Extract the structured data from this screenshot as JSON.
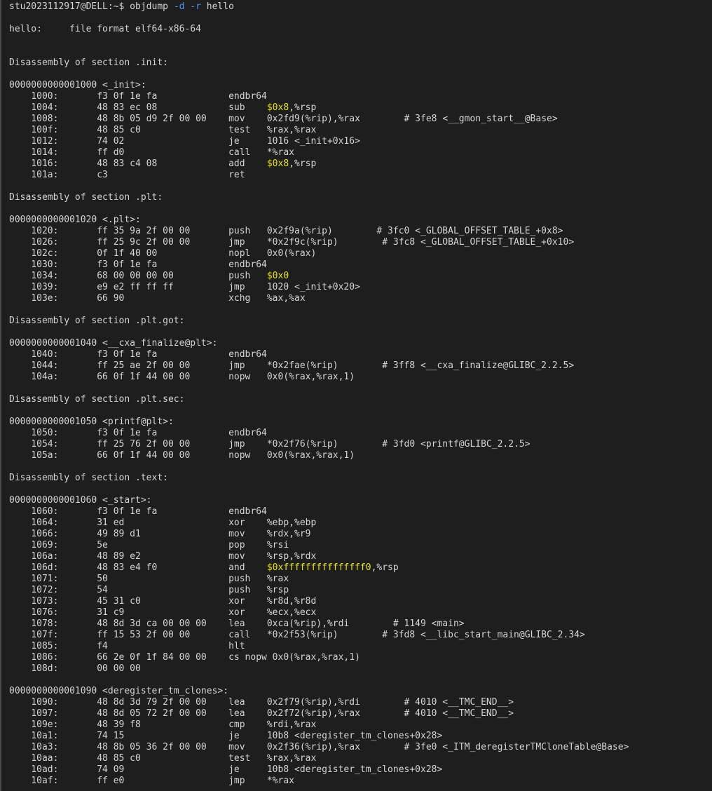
{
  "terminal": {
    "colors": {
      "background": "#1e1e1e",
      "foreground": "#d4d4d4",
      "option": "#4f8ff0",
      "immediate": "#e5e510"
    },
    "lines": [
      [
        {
          "t": "stu2023112917@DELL:~$ objdump "
        },
        {
          "t": "-d",
          "c": "opt"
        },
        {
          "t": " "
        },
        {
          "t": "-r",
          "c": "opt"
        },
        {
          "t": " hello"
        }
      ],
      [
        {
          "t": ""
        }
      ],
      [
        {
          "t": "hello:     file format elf64-x86-64"
        }
      ],
      [
        {
          "t": ""
        }
      ],
      [
        {
          "t": ""
        }
      ],
      [
        {
          "t": "Disassembly of section .init:"
        }
      ],
      [
        {
          "t": ""
        }
      ],
      [
        {
          "t": "0000000000001000 <_init>:"
        }
      ],
      [
        {
          "t": "    1000:       f3 0f 1e fa             endbr64"
        }
      ],
      [
        {
          "t": "    1004:       48 83 ec 08             sub    "
        },
        {
          "t": "$0x8",
          "c": "imm"
        },
        {
          "t": ",%rsp"
        }
      ],
      [
        {
          "t": "    1008:       48 8b 05 d9 2f 00 00    mov    "
        },
        {
          "t": "0x2fd9(%rip),%rax        # 3fe8 <__gmon_start__@Base>"
        }
      ],
      [
        {
          "t": "    100f:       48 85 c0                test   %rax,%rax"
        }
      ],
      [
        {
          "t": "    1012:       74 02                   je     1016 <_init+0x16>"
        }
      ],
      [
        {
          "t": "    1014:       ff d0                   call   *%rax"
        }
      ],
      [
        {
          "t": "    1016:       48 83 c4 08             add    "
        },
        {
          "t": "$0x8",
          "c": "imm"
        },
        {
          "t": ",%rsp"
        }
      ],
      [
        {
          "t": "    101a:       c3                      ret"
        }
      ],
      [
        {
          "t": ""
        }
      ],
      [
        {
          "t": "Disassembly of section .plt:"
        }
      ],
      [
        {
          "t": ""
        }
      ],
      [
        {
          "t": "0000000000001020 <.plt>:"
        }
      ],
      [
        {
          "t": "    1020:       ff 35 9a 2f 00 00       push   0x2f9a(%rip)        # 3fc0 <_GLOBAL_OFFSET_TABLE_+0x8>"
        }
      ],
      [
        {
          "t": "    1026:       ff 25 9c 2f 00 00       jmp    *0x2f9c(%rip)        # 3fc8 <_GLOBAL_OFFSET_TABLE_+0x10>"
        }
      ],
      [
        {
          "t": "    102c:       0f 1f 40 00             nopl   0x0(%rax)"
        }
      ],
      [
        {
          "t": "    1030:       f3 0f 1e fa             endbr64"
        }
      ],
      [
        {
          "t": "    1034:       68 00 00 00 00          push   "
        },
        {
          "t": "$0x0",
          "c": "imm"
        }
      ],
      [
        {
          "t": "    1039:       e9 e2 ff ff ff          jmp    1020 <_init+0x20>"
        }
      ],
      [
        {
          "t": "    103e:       66 90                   xchg   %ax,%ax"
        }
      ],
      [
        {
          "t": ""
        }
      ],
      [
        {
          "t": "Disassembly of section .plt.got:"
        }
      ],
      [
        {
          "t": ""
        }
      ],
      [
        {
          "t": "0000000000001040 <__cxa_finalize@plt>:"
        }
      ],
      [
        {
          "t": "    1040:       f3 0f 1e fa             endbr64"
        }
      ],
      [
        {
          "t": "    1044:       ff 25 ae 2f 00 00       jmp    *0x2fae(%rip)        # 3ff8 <__cxa_finalize@GLIBC_2.2.5>"
        }
      ],
      [
        {
          "t": "    104a:       66 0f 1f 44 00 00       nopw   0x0(%rax,%rax,1)"
        }
      ],
      [
        {
          "t": ""
        }
      ],
      [
        {
          "t": "Disassembly of section .plt.sec:"
        }
      ],
      [
        {
          "t": ""
        }
      ],
      [
        {
          "t": "0000000000001050 <printf@plt>:"
        }
      ],
      [
        {
          "t": "    1050:       f3 0f 1e fa             endbr64"
        }
      ],
      [
        {
          "t": "    1054:       ff 25 76 2f 00 00       jmp    *0x2f76(%rip)        # 3fd0 <printf@GLIBC_2.2.5>"
        }
      ],
      [
        {
          "t": "    105a:       66 0f 1f 44 00 00       nopw   0x0(%rax,%rax,1)"
        }
      ],
      [
        {
          "t": ""
        }
      ],
      [
        {
          "t": "Disassembly of section .text:"
        }
      ],
      [
        {
          "t": ""
        }
      ],
      [
        {
          "t": "0000000000001060 <_start>:"
        }
      ],
      [
        {
          "t": "    1060:       f3 0f 1e fa             endbr64"
        }
      ],
      [
        {
          "t": "    1064:       31 ed                   xor    %ebp,%ebp"
        }
      ],
      [
        {
          "t": "    1066:       49 89 d1                mov    %rdx,%r9"
        }
      ],
      [
        {
          "t": "    1069:       5e                      pop    %rsi"
        }
      ],
      [
        {
          "t": "    106a:       48 89 e2                mov    %rsp,%rdx"
        }
      ],
      [
        {
          "t": "    106d:       48 83 e4 f0             and    "
        },
        {
          "t": "$0xfffffffffffffff0",
          "c": "imm"
        },
        {
          "t": ",%rsp"
        }
      ],
      [
        {
          "t": "    1071:       50                      push   %rax"
        }
      ],
      [
        {
          "t": "    1072:       54                      push   %rsp"
        }
      ],
      [
        {
          "t": "    1073:       45 31 c0                xor    %r8d,%r8d"
        }
      ],
      [
        {
          "t": "    1076:       31 c9                   xor    %ecx,%ecx"
        }
      ],
      [
        {
          "t": "    1078:       48 8d 3d ca 00 00 00    lea    0xca(%rip),%rdi        # 1149 <main>"
        }
      ],
      [
        {
          "t": "    107f:       ff 15 53 2f 00 00       call   *0x2f53(%rip)        # 3fd8 <__libc_start_main@GLIBC_2.34>"
        }
      ],
      [
        {
          "t": "    1085:       f4                      hlt"
        }
      ],
      [
        {
          "t": "    1086:       66 2e 0f 1f 84 00 00    cs nopw 0x0(%rax,%rax,1)"
        }
      ],
      [
        {
          "t": "    108d:       00 00 00"
        }
      ],
      [
        {
          "t": ""
        }
      ],
      [
        {
          "t": "0000000000001090 <deregister_tm_clones>:"
        }
      ],
      [
        {
          "t": "    1090:       48 8d 3d 79 2f 00 00    lea    0x2f79(%rip),%rdi        # 4010 <__TMC_END__>"
        }
      ],
      [
        {
          "t": "    1097:       48 8d 05 72 2f 00 00    lea    0x2f72(%rip),%rax        # 4010 <__TMC_END__>"
        }
      ],
      [
        {
          "t": "    109e:       48 39 f8                cmp    %rdi,%rax"
        }
      ],
      [
        {
          "t": "    10a1:       74 15                   je     10b8 <deregister_tm_clones+0x28>"
        }
      ],
      [
        {
          "t": "    10a3:       48 8b 05 36 2f 00 00    mov    0x2f36(%rip),%rax        # 3fe0 <_ITM_deregisterTMCloneTable@Base>"
        }
      ],
      [
        {
          "t": "    10aa:       48 85 c0                test   %rax,%rax"
        }
      ],
      [
        {
          "t": "    10ad:       74 09                   je     10b8 <deregister_tm_clones+0x28>"
        }
      ],
      [
        {
          "t": "    10af:       ff e0                   jmp    *%rax"
        }
      ]
    ]
  }
}
